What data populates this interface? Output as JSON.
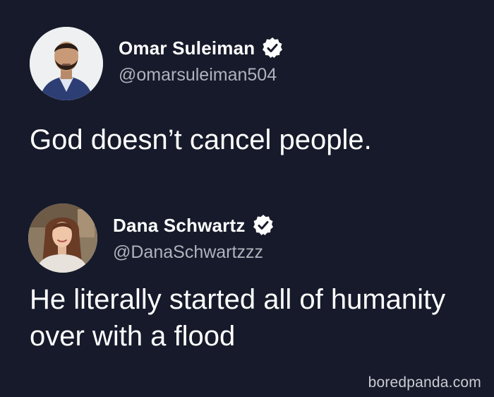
{
  "tweets": [
    {
      "name": "Omar Suleiman",
      "handle": "@omarsuleiman504",
      "verified": true,
      "text": "God doesn’t cancel people.",
      "avatar_icon": "avatar-omar"
    },
    {
      "name": "Dana Schwartz",
      "handle": "@DanaSchwartzzz",
      "verified": true,
      "text": "He literally started all of humanity over with a flood",
      "avatar_icon": "avatar-dana"
    }
  ],
  "watermark": "boredpanda.com",
  "colors": {
    "background": "#161a2a",
    "text": "#ffffff",
    "handle": "#aeb3bc",
    "badge": "#ffffff",
    "badge_check": "#161a2a"
  }
}
